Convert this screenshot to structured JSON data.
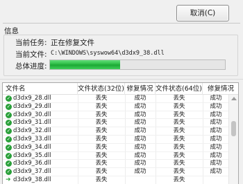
{
  "toolbar": {
    "cancel_label": "取消(C)"
  },
  "info": {
    "title": "信息",
    "task_label": "当前任务:",
    "task_value": "正在修复文件",
    "file_label": "当前文件:",
    "file_value": "C:\\WINDOWS\\syswow64\\d3dx9_38.dll",
    "progress_label": "总体进度:",
    "progress_value": 0.4
  },
  "table": {
    "headers": [
      "文件名",
      "文件状态(32位)",
      "修复情况",
      "文件状态(64位)",
      "修复情况"
    ],
    "rows": [
      {
        "name": "d3dx9_28.dll",
        "s32": "丢失",
        "r32": "成功",
        "s64": "丢失",
        "r64": "成功",
        "icon": "check-icon"
      },
      {
        "name": "d3dx9_29.dll",
        "s32": "丢失",
        "r32": "成功",
        "s64": "丢失",
        "r64": "成功",
        "icon": "check-icon"
      },
      {
        "name": "d3dx9_30.dll",
        "s32": "丢失",
        "r32": "成功",
        "s64": "丢失",
        "r64": "成功",
        "icon": "check-icon"
      },
      {
        "name": "d3dx9_31.dll",
        "s32": "丢失",
        "r32": "成功",
        "s64": "丢失",
        "r64": "成功",
        "icon": "check-icon"
      },
      {
        "name": "d3dx9_32.dll",
        "s32": "丢失",
        "r32": "成功",
        "s64": "丢失",
        "r64": "成功",
        "icon": "check-icon"
      },
      {
        "name": "d3dx9_33.dll",
        "s32": "丢失",
        "r32": "成功",
        "s64": "丢失",
        "r64": "成功",
        "icon": "check-icon"
      },
      {
        "name": "d3dx9_34.dll",
        "s32": "丢失",
        "r32": "成功",
        "s64": "丢失",
        "r64": "成功",
        "icon": "check-icon"
      },
      {
        "name": "d3dx9_35.dll",
        "s32": "丢失",
        "r32": "成功",
        "s64": "丢失",
        "r64": "成功",
        "icon": "check-icon"
      },
      {
        "name": "d3dx9_36.dll",
        "s32": "丢失",
        "r32": "成功",
        "s64": "丢失",
        "r64": "成功",
        "icon": "check-icon"
      },
      {
        "name": "d3dx9_37.dll",
        "s32": "丢失",
        "r32": "成功",
        "s64": "丢失",
        "r64": "成功",
        "icon": "check-icon"
      },
      {
        "name": "d3dx9_38.dll",
        "s32": "丢失",
        "r32": "",
        "s64": "丢失",
        "r64": "",
        "icon": "arrow-right-icon"
      }
    ]
  }
}
